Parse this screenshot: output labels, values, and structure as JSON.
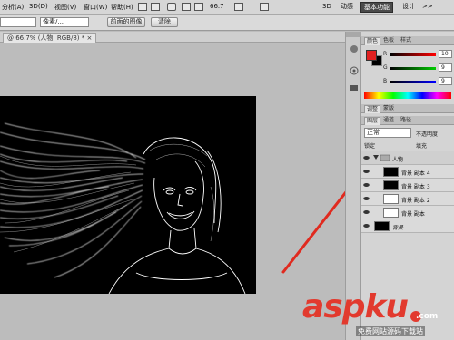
{
  "menu": {
    "items": [
      "分析(A)",
      "3D(D)",
      "视图(V)",
      "窗口(W)",
      "帮助(H)"
    ],
    "zoom": "66.7",
    "workspace": [
      "3D",
      "动感",
      "基本功能",
      "设计",
      ">>"
    ]
  },
  "options": {
    "style_value": "",
    "unit_value": "像素/...",
    "front_image_label": "前面的图像",
    "clear_label": "清除"
  },
  "document": {
    "tab_label": "@ 66.7% (人物, RGB/8) * ×"
  },
  "color_panel": {
    "tabs": [
      "颜色",
      "色板",
      "样式"
    ],
    "r_label": "R",
    "g_label": "G",
    "b_label": "B",
    "r_value": "10",
    "g_value": "9",
    "b_value": "9",
    "fg_color": "#e02020",
    "bg_color": "#000000"
  },
  "adjust_panel": {
    "tabs": [
      "调整",
      "蒙版"
    ]
  },
  "layers_panel": {
    "tabs": [
      "图层",
      "通道",
      "路径"
    ],
    "blend_mode": "正常",
    "opacity_label": "不透明度",
    "fill_label": "填充",
    "lock_label": "锁定",
    "group_name": "人物",
    "layers": [
      {
        "name": "背景 副本 4"
      },
      {
        "name": "背景 副本 3"
      },
      {
        "name": "背景 副本 2"
      },
      {
        "name": "背景 副本"
      },
      {
        "name": "背景"
      }
    ]
  },
  "watermark": {
    "brand": "aspku",
    "suffix": ".com",
    "tagline": "免费网站源码下载站"
  },
  "colors": {
    "accent_red": "#e23a2e",
    "arrow_red": "#e02a1f"
  }
}
